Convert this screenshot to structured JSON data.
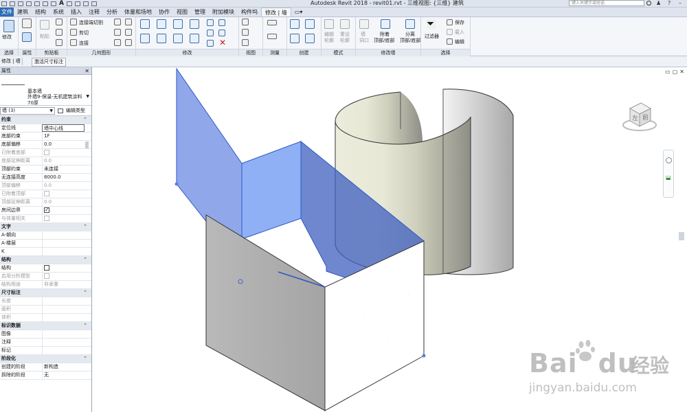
{
  "titlebar": {
    "title": "Autodesk Revit 2018 -     revit01.rvt - 三维视图: {三维} 建筑",
    "search_placeholder": "键入关键字或短语"
  },
  "ribbon_tabs": [
    {
      "label": "文件"
    },
    {
      "label": "建筑"
    },
    {
      "label": "结构"
    },
    {
      "label": "系统"
    },
    {
      "label": "插入"
    },
    {
      "label": "注释"
    },
    {
      "label": "分析"
    },
    {
      "label": "体量和场地"
    },
    {
      "label": "协作"
    },
    {
      "label": "视图"
    },
    {
      "label": "管理"
    },
    {
      "label": "附加模块"
    },
    {
      "label": "构件坞"
    },
    {
      "label": "修改 | 墙",
      "active": true
    }
  ],
  "ribbon": {
    "modify": "修改",
    "paste": "粘贴",
    "join_cut": "连接端切割",
    "cut": "剪切",
    "join": "连接",
    "group_select": "选择",
    "group_properties": "属性",
    "group_clipboard": "剪贴板",
    "group_geometry": "几何图形",
    "group_modify": "修改",
    "group_view": "视图",
    "group_measure": "测量",
    "group_create": "创建",
    "group_mode": "模式",
    "group_modify_wall": "修改墙",
    "group_select2": "选择",
    "edit_profile_1": "编辑",
    "edit_profile_2": "轮廓",
    "reset_profile_1": "重设",
    "reset_profile_2": "轮廓",
    "wall_opening_1": "墙",
    "wall_opening_2": "洞口",
    "attach_1": "附着",
    "attach_2": "顶部/底部",
    "detach_1": "分离",
    "detach_2": "顶部/底部",
    "filter": "过滤器",
    "save": "保存",
    "load": "载入",
    "edit": "编辑"
  },
  "optbar": {
    "context": "修改 | 墙",
    "activate_dims": "激活尺寸标注"
  },
  "properties": {
    "header": "属性",
    "type_family": "基本墙",
    "type_name": "外墙9-保温-无机建筑涂料",
    "type_thickness": "70厚",
    "filter_value": "墙 (3)",
    "edit_type": "编辑类型",
    "rows": [
      {
        "kind": "section",
        "name": "约束"
      },
      {
        "name": "定位线",
        "value": "墙中心线",
        "boxed": true
      },
      {
        "name": "底部约束",
        "value": "1F"
      },
      {
        "name": "底部偏移",
        "value": "0.0"
      },
      {
        "name": "已附着底部",
        "value": "",
        "checkbox": "dim",
        "dim": true
      },
      {
        "name": "底部延伸距离",
        "value": "0.0",
        "dim": true
      },
      {
        "name": "顶部约束",
        "value": "未连接"
      },
      {
        "name": "无连接高度",
        "value": "8000.0"
      },
      {
        "name": "顶部偏移",
        "value": "0.0",
        "dim": true
      },
      {
        "name": "已附着顶部",
        "value": "",
        "checkbox": "dim",
        "dim": true
      },
      {
        "name": "顶部延伸距离",
        "value": "0.0",
        "dim": true
      },
      {
        "name": "房间边界",
        "value": "",
        "checkbox": "checked"
      },
      {
        "name": "与体量相关",
        "value": "",
        "checkbox": "dim",
        "dim": true
      },
      {
        "kind": "section",
        "name": "文字"
      },
      {
        "name": "A-朝向",
        "value": ""
      },
      {
        "name": "A-楼层",
        "value": ""
      },
      {
        "name": "K",
        "value": ""
      },
      {
        "kind": "section",
        "name": "结构"
      },
      {
        "name": "结构",
        "value": "",
        "checkbox": "empty"
      },
      {
        "name": "启用分析模型",
        "value": "",
        "checkbox": "dim",
        "dim": true
      },
      {
        "name": "结构用途",
        "value": "非承重",
        "dim": true
      },
      {
        "kind": "section",
        "name": "尺寸标注"
      },
      {
        "name": "长度",
        "value": "",
        "dim": true
      },
      {
        "name": "面积",
        "value": "",
        "dim": true
      },
      {
        "name": "体积",
        "value": "",
        "dim": true
      },
      {
        "kind": "section",
        "name": "标识数据"
      },
      {
        "name": "图像",
        "value": ""
      },
      {
        "name": "注释",
        "value": ""
      },
      {
        "name": "标记",
        "value": ""
      },
      {
        "kind": "section",
        "name": "阶段化"
      },
      {
        "name": "创建的阶段",
        "value": "新构造"
      },
      {
        "name": "拆除的阶段",
        "value": "无"
      }
    ]
  },
  "viewcube": {
    "left": "左",
    "front": "前"
  },
  "watermark": {
    "brand": "Bai",
    "brand2": "du",
    "jingyan": "经验",
    "url": "jingyan.baidu.com"
  },
  "colors": {
    "selection_blue": "#3f66d6",
    "wall_blue": "#7e9be8",
    "wall_gray": "#b3b3b3",
    "ribbon_bg": "#f4f6f9"
  }
}
